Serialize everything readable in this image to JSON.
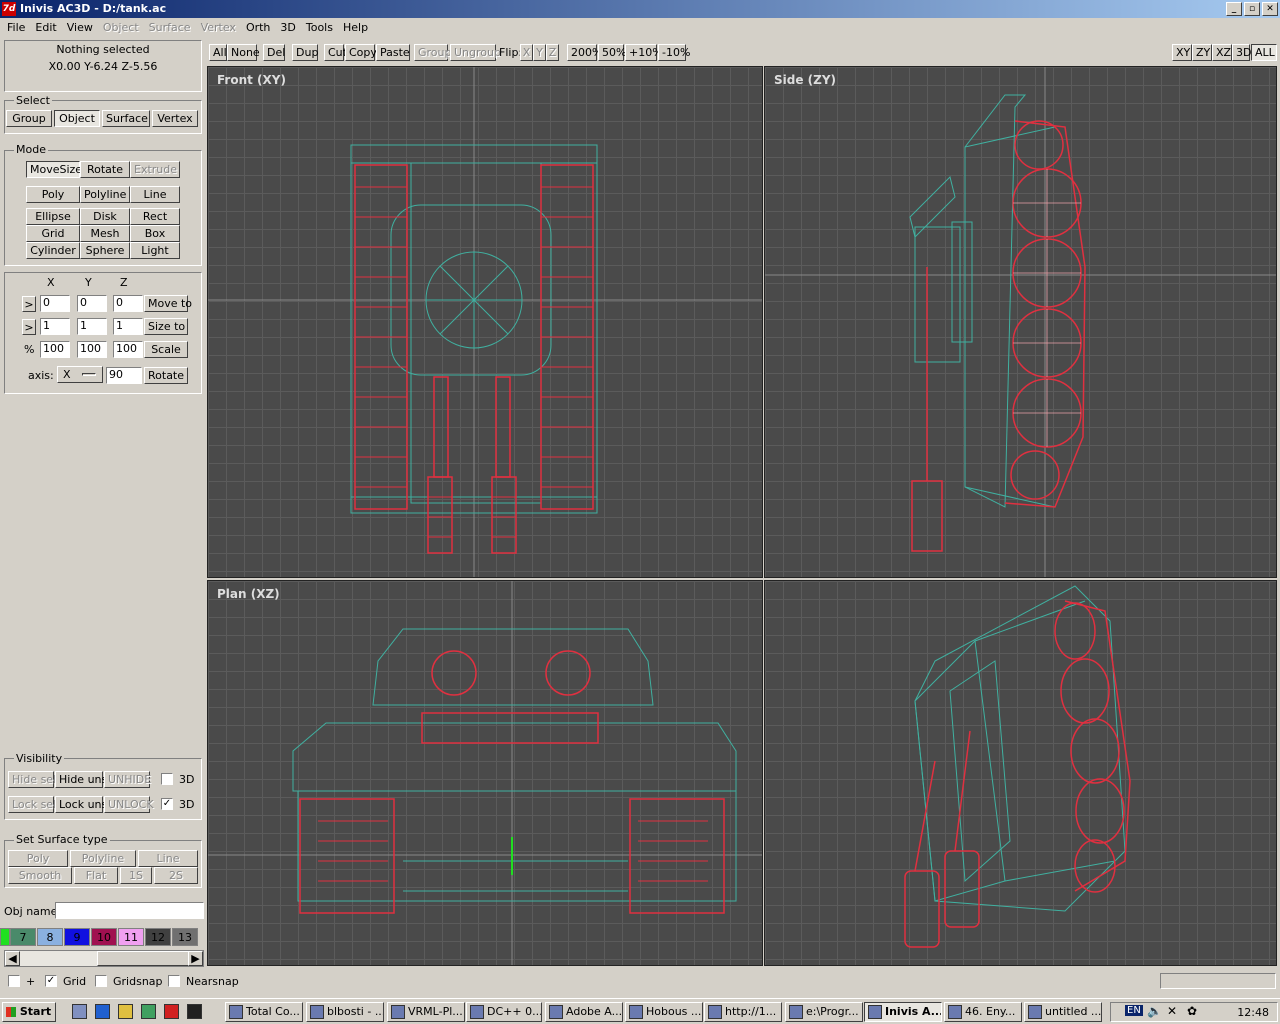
{
  "window": {
    "title": "Inivis AC3D - D:/tank.ac",
    "app_icon": "7d"
  },
  "menu": [
    {
      "label": "File",
      "enabled": true
    },
    {
      "label": "Edit",
      "enabled": true
    },
    {
      "label": "View",
      "enabled": true
    },
    {
      "label": "Object",
      "enabled": false
    },
    {
      "label": "Surface",
      "enabled": false
    },
    {
      "label": "Vertex",
      "enabled": false
    },
    {
      "label": "Orth",
      "enabled": true
    },
    {
      "label": "3D",
      "enabled": true
    },
    {
      "label": "Tools",
      "enabled": true
    },
    {
      "label": "Help",
      "enabled": true
    }
  ],
  "status": {
    "selection": "Nothing selected",
    "coords": "X0.00 Y-6.24 Z-5.56"
  },
  "select_group": {
    "label": "Select",
    "buttons": [
      "Group",
      "Object",
      "Surface",
      "Vertex"
    ],
    "active": "Object"
  },
  "mode_group": {
    "label": "Mode",
    "buttons": [
      "MoveSize",
      "Rotate",
      "Extrude",
      "Poly",
      "Polyline",
      "Line",
      "Ellipse",
      "Disk",
      "Rect",
      "Grid",
      "Mesh",
      "Box",
      "Cylinder",
      "Sphere",
      "Light"
    ],
    "active": "MoveSize",
    "disabled": [
      "Extrude"
    ]
  },
  "transform": {
    "axis_headers": [
      "X",
      "Y",
      "Z"
    ],
    "move": {
      "arrow": ">",
      "x": "0",
      "y": "0",
      "z": "0",
      "button": "Move to"
    },
    "size": {
      "arrow": ">",
      "x": "1",
      "y": "1",
      "z": "1",
      "button": "Size to"
    },
    "scale": {
      "label": "%",
      "x": "100",
      "y": "100",
      "z": "100",
      "button": "Scale"
    },
    "rotate": {
      "axis_label": "axis:",
      "axis_value": "X",
      "angle": "90",
      "button": "Rotate"
    }
  },
  "visibility": {
    "label": "Visibility",
    "buttons": [
      "Hide sel",
      "Hide uns",
      "UNHIDE",
      "Lock sel",
      "Lock uns",
      "UNLOCK"
    ],
    "disabled": [
      "Hide sel",
      "UNHIDE",
      "Lock sel",
      "UNLOCK"
    ],
    "check1": {
      "label": "3D",
      "checked": false
    },
    "check2": {
      "label": "3D",
      "checked": true
    }
  },
  "surface_type": {
    "label": "Set Surface type",
    "buttons": [
      "Poly",
      "Polyline",
      "Line",
      "Smooth",
      "Flat",
      "1S",
      "2S"
    ]
  },
  "obj_name": {
    "label": "Obj name:",
    "value": ""
  },
  "palette": [
    {
      "n": "",
      "c": "#20e020"
    },
    {
      "n": "7",
      "c": "#4a8a6a"
    },
    {
      "n": "8",
      "c": "#8ab0e0"
    },
    {
      "n": "9",
      "c": "#1010e0"
    },
    {
      "n": "10",
      "c": "#a01050"
    },
    {
      "n": "11",
      "c": "#f0a0f0"
    },
    {
      "n": "12",
      "c": "#404040"
    },
    {
      "n": "13",
      "c": "#707070"
    }
  ],
  "toolbar": {
    "buttons": [
      "All",
      "None",
      "Del",
      "Dup",
      "Cut",
      "Copy",
      "Paste",
      "Group",
      "Ungroup"
    ],
    "disabled": [
      "Group",
      "Ungroup"
    ],
    "flip_label": "Flip:",
    "flip": [
      "X",
      "Y",
      "Z"
    ],
    "zoom": [
      "200%",
      "50%",
      "+10%",
      "-10%"
    ],
    "views": [
      "XY",
      "ZY",
      "XZ",
      "3D",
      "ALL"
    ],
    "active_view": "ALL"
  },
  "viewports": {
    "front": "Front (XY)",
    "side": "Side (ZY)",
    "plan": "Plan (XZ)"
  },
  "bottom_options": [
    {
      "label": "+",
      "checked": false
    },
    {
      "label": "Grid",
      "checked": true
    },
    {
      "label": "Gridsnap",
      "checked": false
    },
    {
      "label": "Nearsnap",
      "checked": false
    }
  ],
  "taskbar": {
    "start": "Start",
    "tasks": [
      "Total Co...",
      "blbosti - ...",
      "VRML-Pl...",
      "DC++ 0...",
      "Adobe A...",
      "Hobous ...",
      "http://1...",
      "e:\\Progr...",
      "Inivis A...",
      "46. Eny...",
      "untitled ..."
    ],
    "active": "Inivis A...",
    "lang": "EN",
    "clock": "12:48"
  },
  "colors": {
    "wire_red": "#e03040",
    "wire_green": "#40b0a0",
    "viewport_bg": "#4a4a4a"
  }
}
